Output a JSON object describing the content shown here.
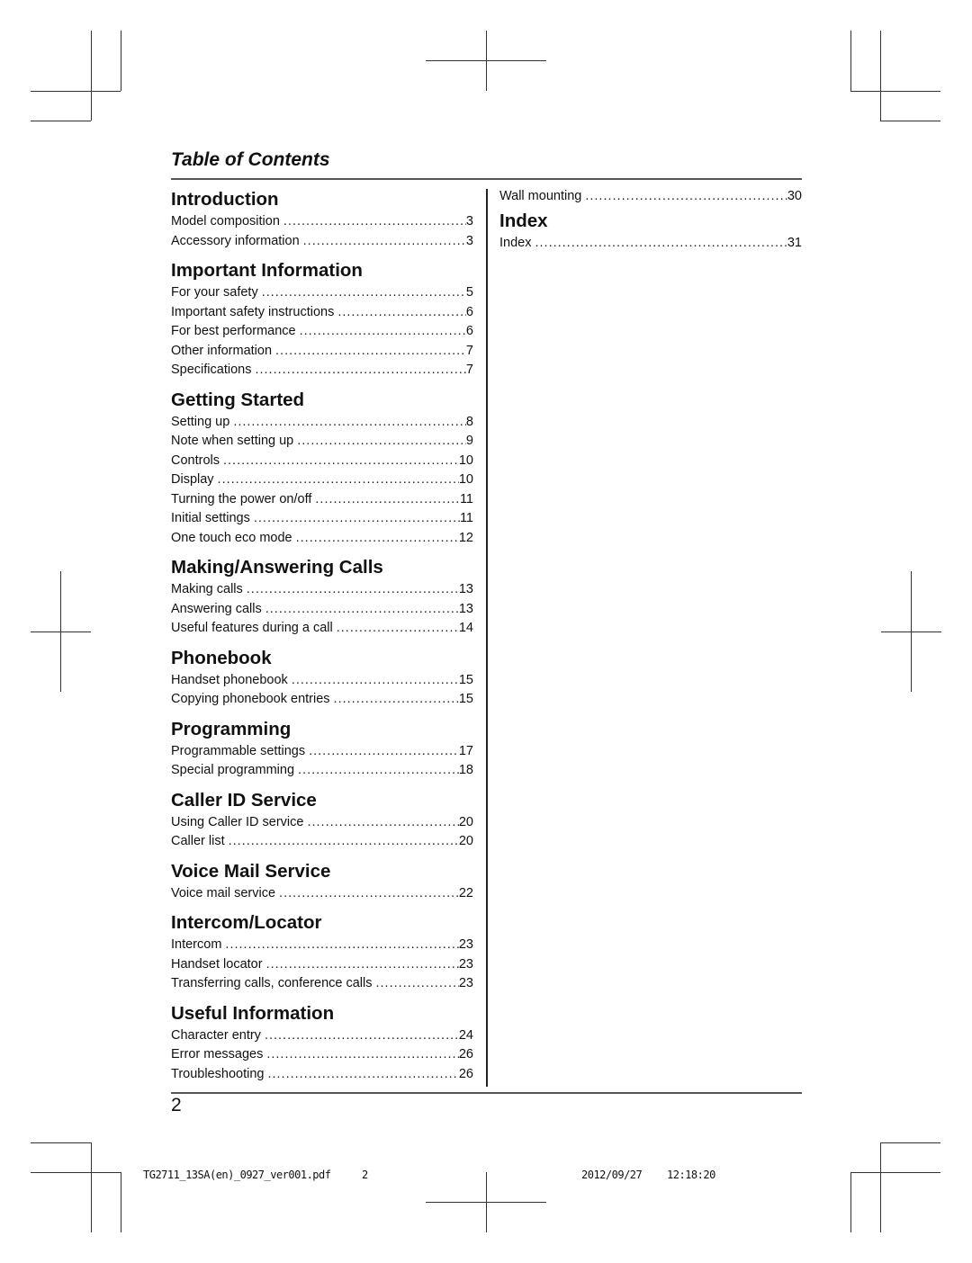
{
  "header": {
    "title": "Table of Contents"
  },
  "left_column": {
    "sections": [
      {
        "title": "Introduction",
        "entries": [
          {
            "label": "Model composition",
            "page": "3"
          },
          {
            "label": "Accessory information",
            "page": "3"
          }
        ]
      },
      {
        "title": "Important Information",
        "entries": [
          {
            "label": "For your safety",
            "page": "5"
          },
          {
            "label": "Important safety instructions",
            "page": "6"
          },
          {
            "label": "For best performance",
            "page": "6"
          },
          {
            "label": "Other information",
            "page": "7"
          },
          {
            "label": "Specifications",
            "page": "7"
          }
        ]
      },
      {
        "title": "Getting Started",
        "entries": [
          {
            "label": "Setting up",
            "page": "8"
          },
          {
            "label": "Note when setting up",
            "page": "9"
          },
          {
            "label": "Controls",
            "page": "10"
          },
          {
            "label": "Display",
            "page": "10"
          },
          {
            "label": "Turning the power on/off",
            "page": "11"
          },
          {
            "label": "Initial settings",
            "page": "11"
          },
          {
            "label": "One touch eco mode",
            "page": "12"
          }
        ]
      },
      {
        "title": "Making/Answering Calls",
        "entries": [
          {
            "label": "Making calls",
            "page": "13"
          },
          {
            "label": "Answering calls",
            "page": "13"
          },
          {
            "label": "Useful features during a call",
            "page": "14"
          }
        ]
      },
      {
        "title": "Phonebook",
        "entries": [
          {
            "label": "Handset phonebook",
            "page": "15"
          },
          {
            "label": "Copying phonebook entries",
            "page": "15"
          }
        ]
      },
      {
        "title": "Programming",
        "entries": [
          {
            "label": "Programmable settings",
            "page": "17"
          },
          {
            "label": "Special programming",
            "page": "18"
          }
        ]
      },
      {
        "title": "Caller ID Service",
        "entries": [
          {
            "label": "Using Caller ID service",
            "page": "20"
          },
          {
            "label": "Caller list",
            "page": "20"
          }
        ]
      },
      {
        "title": "Voice Mail Service",
        "entries": [
          {
            "label": "Voice mail service",
            "page": "22"
          }
        ]
      },
      {
        "title": "Intercom/Locator",
        "entries": [
          {
            "label": "Intercom",
            "page": "23"
          },
          {
            "label": "Handset locator",
            "page": "23"
          },
          {
            "label": "Transferring calls, conference calls",
            "page": "23"
          }
        ]
      },
      {
        "title": "Useful Information",
        "entries": [
          {
            "label": "Character entry",
            "page": "24"
          },
          {
            "label": "Error messages",
            "page": "26"
          },
          {
            "label": "Troubleshooting",
            "page": "26"
          }
        ]
      }
    ]
  },
  "right_column": {
    "top_entry": {
      "label": "Wall mounting",
      "page": "30"
    },
    "sections": [
      {
        "title": "Index",
        "entries": [
          {
            "label": "Index",
            "page": "31"
          }
        ]
      }
    ]
  },
  "page_number": "2",
  "print_footer": {
    "file": "TG2711_13SA(en)_0927_ver001.pdf",
    "page": "2",
    "date": "2012/09/27",
    "time": "12:18:20"
  }
}
